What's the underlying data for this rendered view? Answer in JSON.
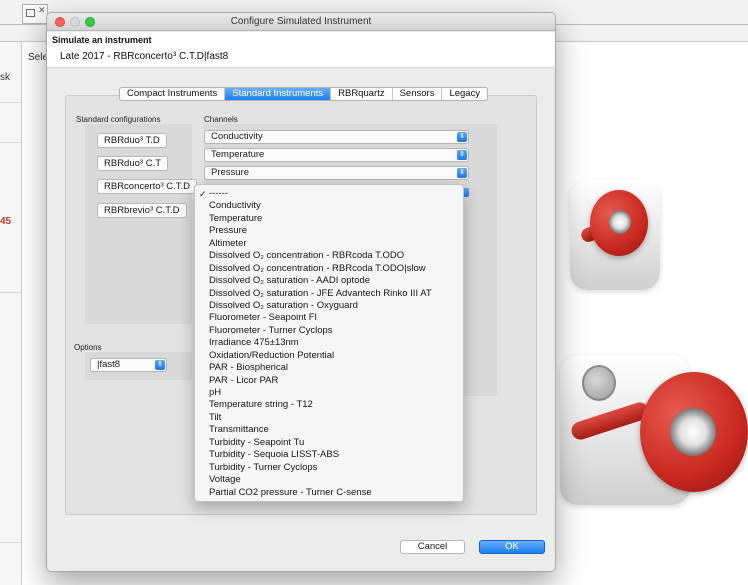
{
  "background": {
    "left_fragment_1": "sk",
    "left_fragment_2": "45",
    "sele_fragment": "Sele"
  },
  "dialog": {
    "window_title": "Configure Simulated Instrument",
    "heading": "Simulate an instrument",
    "subheading": "Late 2017  -  RBRconcerto³ C.T.D|fast8",
    "tabs": [
      {
        "label": "Compact Instruments",
        "active": false
      },
      {
        "label": "Standard Instruments",
        "active": true
      },
      {
        "label": "RBRquartz",
        "active": false
      },
      {
        "label": "Sensors",
        "active": false
      },
      {
        "label": "Legacy",
        "active": false
      }
    ],
    "standard_configurations_label": "Standard configurations",
    "configurations": [
      "RBRduo³ T.D",
      "RBRduo³ C.T",
      "RBRconcerto³ C.T.D",
      "RBRbrevio³ C.T.D"
    ],
    "options_label": "Options",
    "options_value": "|fast8",
    "channels_label": "Channels",
    "channels": [
      "Conductivity",
      "Temperature",
      "Pressure"
    ],
    "menu_items": [
      "------",
      "Conductivity",
      "Temperature",
      "Pressure",
      "Altimeter",
      "Dissolved O₂ concentration  -  RBRcoda T.ODO",
      "Dissolved O₂ concentration  -  RBRcoda T.ODO|slow",
      "Dissolved O₂ saturation  -  AADI optode",
      "Dissolved O₂ saturation  -  JFE Advantech Rinko III AT",
      "Dissolved O₂ saturation  -  Oxyguard",
      "Fluorometer  -  Seapoint Fl",
      "Fluorometer  -  Turner Cyclops",
      "Irradiance 475±13nm",
      "Oxidation/Reduction Potential",
      "PAR  -  Biospherical",
      "PAR  -  Licor PAR",
      "pH",
      "Temperature string  - T12",
      "Tilt",
      "Transmittance",
      "Turbidity  -  Seapoint Tu",
      "Turbidity  -  Sequoia LISST-ABS",
      "Turbidity  -  Turner Cyclops",
      "Voltage",
      "Partial CO2 pressure - Turner C-sense"
    ],
    "menu_checked_index": 0,
    "check_glyph": "✓",
    "cancel_label": "Cancel",
    "ok_label": "OK"
  },
  "colors": {
    "accent": "#1a7ff0",
    "close": "#fc605c",
    "zoom": "#34c84a",
    "product_red": "#c8281f"
  },
  "icons": {
    "stepper": "up-down-chevron-icon",
    "window_close": "close-icon"
  }
}
